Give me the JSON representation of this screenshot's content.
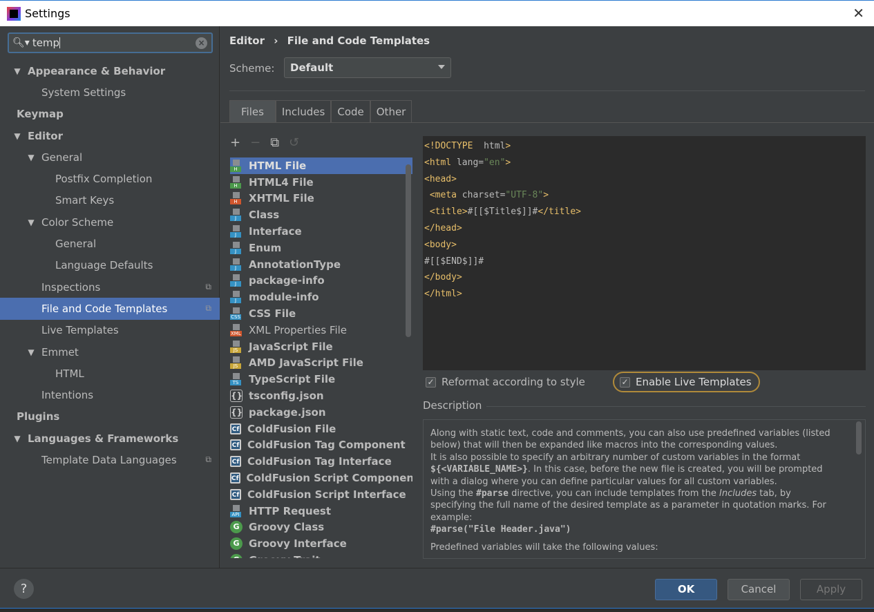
{
  "window": {
    "title": "Settings",
    "close": "✕"
  },
  "search": {
    "value": "temp"
  },
  "tree": [
    {
      "label": "Appearance & Behavior",
      "level": 0,
      "arrow": "▼",
      "bold": true
    },
    {
      "label": "System Settings",
      "level": 1
    },
    {
      "label": "Keymap",
      "level": 0,
      "bold": true
    },
    {
      "label": "Editor",
      "level": 0,
      "arrow": "▼",
      "bold": true
    },
    {
      "label": "General",
      "level": 1,
      "arrow": "▼"
    },
    {
      "label": "Postfix Completion",
      "level": 2
    },
    {
      "label": "Smart Keys",
      "level": 2
    },
    {
      "label": "Color Scheme",
      "level": 1,
      "arrow": "▼"
    },
    {
      "label": "General",
      "level": 2
    },
    {
      "label": "Language Defaults",
      "level": 2
    },
    {
      "label": "Inspections",
      "level": 1,
      "copy": true
    },
    {
      "label": "File and Code Templates",
      "level": 1,
      "copy": true,
      "selected": true
    },
    {
      "label": "Live Templates",
      "level": 1
    },
    {
      "label": "Emmet",
      "level": 1,
      "arrow": "▼"
    },
    {
      "label": "HTML",
      "level": 2
    },
    {
      "label": "Intentions",
      "level": 1
    },
    {
      "label": "Plugins",
      "level": 0,
      "bold": true
    },
    {
      "label": "Languages & Frameworks",
      "level": 0,
      "arrow": "▼",
      "bold": true
    },
    {
      "label": "Template Data Languages",
      "level": 1,
      "copy": true
    }
  ],
  "breadcrumb": {
    "parent": "Editor",
    "sep": "›",
    "current": "File and Code Templates"
  },
  "scheme": {
    "label": "Scheme:",
    "value": "Default"
  },
  "tabs": [
    "Files",
    "Includes",
    "Code",
    "Other"
  ],
  "toolbar": {
    "add": "+",
    "remove": "−",
    "copy": "⧉",
    "reset": "↺"
  },
  "files": [
    {
      "name": "HTML File",
      "icon": "file",
      "color": "#4c9a4c",
      "letter": "H",
      "selected": true
    },
    {
      "name": "HTML4 File",
      "icon": "file",
      "color": "#4c9a4c",
      "letter": "H"
    },
    {
      "name": "XHTML File",
      "icon": "file",
      "color": "#d0562d",
      "letter": "H"
    },
    {
      "name": "Class",
      "icon": "file",
      "color": "#3592c4",
      "letter": "J"
    },
    {
      "name": "Interface",
      "icon": "file",
      "color": "#3592c4",
      "letter": "J"
    },
    {
      "name": "Enum",
      "icon": "file",
      "color": "#3592c4",
      "letter": "J"
    },
    {
      "name": "AnnotationType",
      "icon": "file",
      "color": "#3592c4",
      "letter": "J"
    },
    {
      "name": "package-info",
      "icon": "file",
      "color": "#3592c4",
      "letter": "J"
    },
    {
      "name": "module-info",
      "icon": "file",
      "color": "#3592c4",
      "letter": "J"
    },
    {
      "name": "CSS File",
      "icon": "file",
      "color": "#3592c4",
      "letter": "CSS"
    },
    {
      "name": "XML Properties File",
      "icon": "file",
      "color": "#d0562d",
      "letter": "XML",
      "plain": true
    },
    {
      "name": "JavaScript File",
      "icon": "file",
      "color": "#c9a73a",
      "letter": "JS"
    },
    {
      "name": "AMD JavaScript File",
      "icon": "file",
      "color": "#c9a73a",
      "letter": "JS"
    },
    {
      "name": "TypeScript File",
      "icon": "file",
      "color": "#3592c4",
      "letter": "TS"
    },
    {
      "name": "tsconfig.json",
      "icon": "json",
      "letter": "{}"
    },
    {
      "name": "package.json",
      "icon": "json",
      "letter": "{}"
    },
    {
      "name": "ColdFusion File",
      "icon": "cf",
      "letter": "Cf"
    },
    {
      "name": "ColdFusion Tag Component",
      "icon": "cf",
      "letter": "Cf"
    },
    {
      "name": "ColdFusion Tag Interface",
      "icon": "cf",
      "letter": "Cf"
    },
    {
      "name": "ColdFusion Script Component",
      "icon": "cf",
      "letter": "Cf"
    },
    {
      "name": "ColdFusion Script Interface",
      "icon": "cf",
      "letter": "Cf"
    },
    {
      "name": "HTTP Request",
      "icon": "file",
      "color": "#3592c4",
      "letter": "API"
    },
    {
      "name": "Groovy Class",
      "icon": "groovy",
      "letter": "G"
    },
    {
      "name": "Groovy Interface",
      "icon": "groovy",
      "letter": "G"
    },
    {
      "name": "Groovy Trait",
      "icon": "groovy",
      "letter": "G"
    }
  ],
  "code": [
    [
      [
        "tg",
        "<!DOCTYPE"
      ],
      [
        "",
        "  html"
      ],
      [
        "tg",
        ">"
      ]
    ],
    [
      [
        "tg",
        "<html"
      ],
      [
        "",
        " lang="
      ],
      [
        "st",
        "\"en\""
      ],
      [
        "tg",
        ">"
      ]
    ],
    [
      [
        "tg",
        "<head>"
      ]
    ],
    [
      [
        "",
        " "
      ],
      [
        "tg",
        "<meta"
      ],
      [
        "",
        " charset="
      ],
      [
        "st",
        "\"UTF-8\""
      ],
      [
        "tg",
        ">"
      ]
    ],
    [
      [
        "",
        " "
      ],
      [
        "tg",
        "<title>"
      ],
      [
        "",
        "#[[$Title$]]#"
      ],
      [
        "tg",
        "</title>"
      ]
    ],
    [
      [
        "tg",
        "</head>"
      ]
    ],
    [
      [
        "tg",
        "<body>"
      ]
    ],
    [
      [
        "",
        "#[[$END$]]#"
      ]
    ],
    [
      [
        "tg",
        "</body>"
      ]
    ],
    [
      [
        "tg",
        "</html>"
      ]
    ]
  ],
  "options": {
    "reformat": {
      "label": "Reformat according to style",
      "checked": true
    },
    "live": {
      "label": "Enable Live Templates",
      "checked": true
    }
  },
  "description": {
    "label": "Description",
    "p1": "Along with static text, code and comments, you can also use predefined variables (listed below) that will then be expanded like macros into the corresponding values.",
    "p2a": "It is also possible to specify an arbitrary number of custom variables in the format ",
    "p2b": "${<VARIABLE_NAME>}",
    "p2c": ". In this case, before the new file is created, you will be prompted with a dialog where you can define particular values for all custom variables.",
    "p3a": "Using the ",
    "p3b": "#parse",
    "p3c": " directive, you can include templates from the ",
    "p3d": "Includes",
    "p3e": " tab, by specifying the full name of the desired template as a parameter in quotation marks. For example:",
    "p4": "#parse(\"File Header.java\")",
    "p5": "Predefined variables will take the following values:"
  },
  "footer": {
    "help": "?",
    "ok": "OK",
    "cancel": "Cancel",
    "apply": "Apply"
  }
}
